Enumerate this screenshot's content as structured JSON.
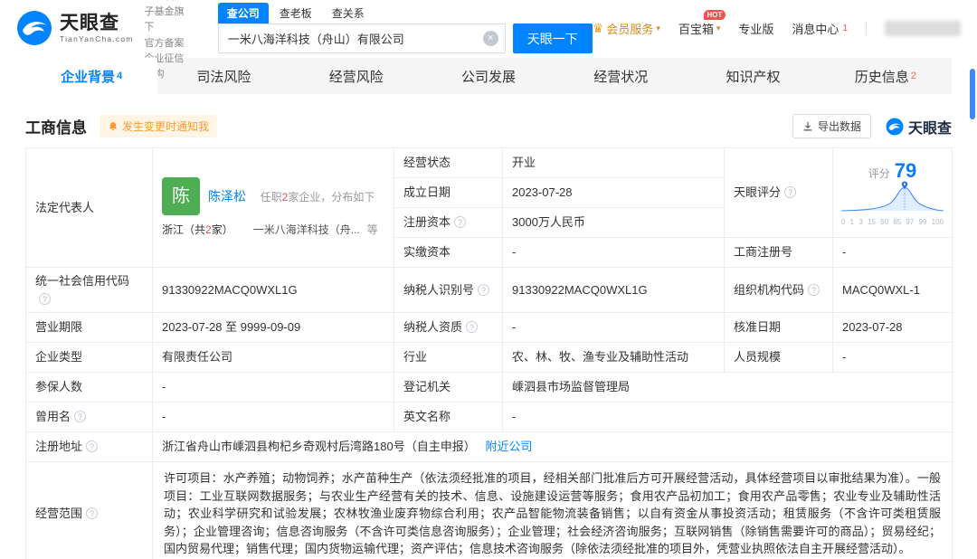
{
  "colors": {
    "accent": "#0084ff",
    "avatar_green": "#4fae53",
    "notify_orange": "#ff9b2f"
  },
  "icons": {
    "chevron_down": "▾",
    "clear": "×",
    "crown": "♛",
    "help": "?"
  },
  "header": {
    "logo": {
      "name": "天眼查",
      "domain": "TianYanCha.com"
    },
    "slogan": {
      "line1": "国家中小企业发展子基金旗下",
      "line2": "官方备案企业征信机构"
    },
    "search": {
      "tabs": [
        {
          "label": "查公司"
        },
        {
          "label": "查老板"
        },
        {
          "label": "查关系"
        }
      ],
      "value": "一米八海洋科技（舟山）有限公司",
      "button": "天眼一下"
    },
    "right": {
      "member": "会员服务",
      "toolbox": "百宝箱",
      "hot": "HOT",
      "pro": "专业版",
      "messages": "消息中心",
      "message_count": "1"
    }
  },
  "nav": {
    "tabs": [
      {
        "label": "企业背景",
        "count": "4"
      },
      {
        "label": "司法风险",
        "count": ""
      },
      {
        "label": "经营风险",
        "count": ""
      },
      {
        "label": "公司发展",
        "count": ""
      },
      {
        "label": "经营状况",
        "count": ""
      },
      {
        "label": "知识产权",
        "count": ""
      },
      {
        "label": "历史信息",
        "count": "2"
      }
    ]
  },
  "section": {
    "title": "工商信息",
    "notify": "发生变更时通知我",
    "export_label": "导出数据",
    "watermark": "天眼查"
  },
  "legal_rep": {
    "label": "法定代表人",
    "avatar_char": "陈",
    "name": "陈泽松",
    "note": [
      "任职",
      "2",
      "家企业，分布如下"
    ],
    "region": [
      "浙江（共",
      "2",
      "家）"
    ],
    "company": "一米八海洋科技（舟...",
    "etc": "等"
  },
  "score": {
    "label": "天眼评分",
    "caption": "评分",
    "value": "79",
    "axis": [
      "0",
      "1",
      "3",
      "15",
      "50",
      "85",
      "97",
      "99",
      "100"
    ]
  },
  "fields": {
    "status": {
      "label": "经营状态",
      "value": "开业"
    },
    "established": {
      "label": "成立日期",
      "value": "2023-07-28"
    },
    "reg_capital": {
      "label": "注册资本",
      "value": "3000万人民币"
    },
    "paid_capital": {
      "label": "实缴资本",
      "value": "-"
    },
    "reg_number": {
      "label": "工商注册号",
      "value": "-"
    },
    "credit_code": {
      "label": "统一社会信用代码",
      "value": "91330922MACQ0WXL1G"
    },
    "taxpayer_id": {
      "label": "纳税人识别号",
      "value": "91330922MACQ0WXL1G"
    },
    "org_code": {
      "label": "组织机构代码",
      "value": "MACQ0WXL-1"
    },
    "business_term": {
      "label": "营业期限",
      "value": "2023-07-28 至 9999-09-09"
    },
    "taxpayer_quality": {
      "label": "纳税人资质",
      "value": "-"
    },
    "approval_date": {
      "label": "核准日期",
      "value": "2023-07-28"
    },
    "company_type": {
      "label": "企业类型",
      "value": "有限责任公司"
    },
    "industry": {
      "label": "行业",
      "value": "农、林、牧、渔专业及辅助性活动"
    },
    "staff_size": {
      "label": "人员规模",
      "value": "-"
    },
    "insured_count": {
      "label": "参保人数",
      "value": "-"
    },
    "registry": {
      "label": "登记机关",
      "value": "嵊泗县市场监督管理局"
    },
    "former_name": {
      "label": "曾用名",
      "value": "-"
    },
    "english_name": {
      "label": "英文名称",
      "value": "-"
    },
    "address": {
      "label": "注册地址",
      "value": "浙江省舟山市嵊泗县枸杞乡奇观村后湾路180号（自主申报）",
      "link": "附近公司"
    },
    "scope": {
      "label": "经营范围",
      "value": "许可项目：水产养殖；动物饲养；水产苗种生产（依法须经批准的项目，经相关部门批准后方可开展经营活动，具体经营项目以审批结果为准）。一般项目：工业互联网数据服务；与农业生产经营有关的技术、信息、设施建设运营等服务；食用农产品初加工；食用农产品零售；农业专业及辅助性活动；农业科学研究和试验发展；农林牧渔业废弃物综合利用；农产品智能物流装备销售；以自有资金从事投资活动；租赁服务（不含许可类租赁服务）；企业管理咨询；信息咨询服务（不含许可类信息咨询服务）；企业管理；社会经济咨询服务；互联网销售（除销售需要许可的商品）；贸易经纪；国内贸易代理；销售代理；国内货物运输代理；资产评估；信息技术咨询服务（除依法须经批准的项目外，凭营业执照依法自主开展经营活动）。"
    }
  }
}
